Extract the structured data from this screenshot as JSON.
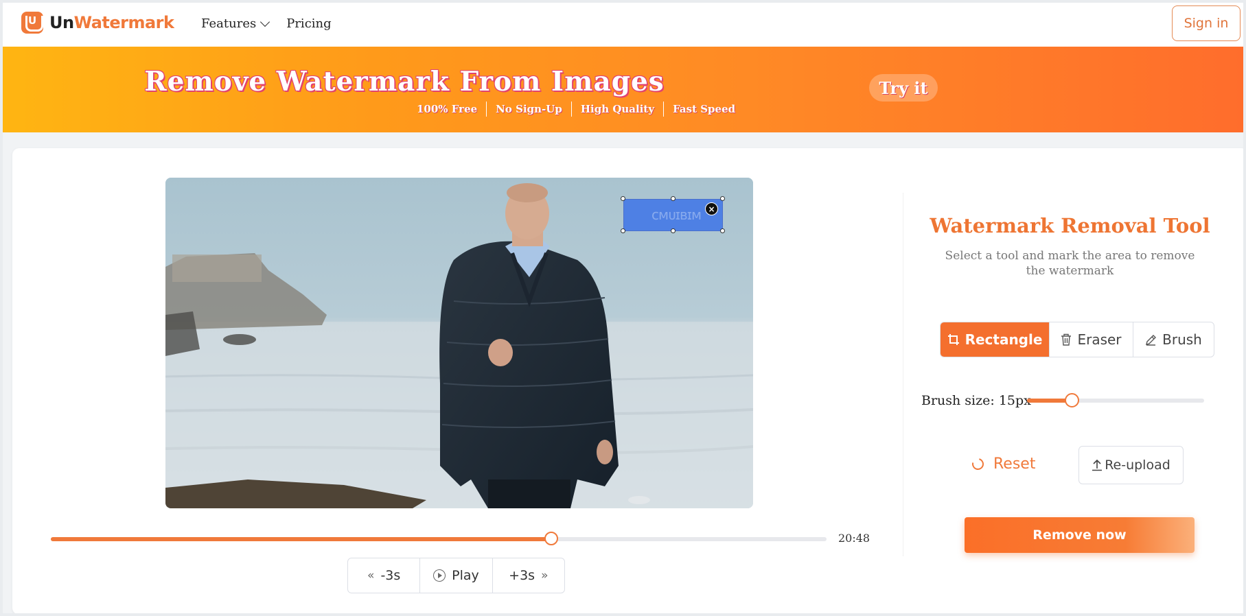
{
  "header": {
    "logo_prefix": "Un",
    "logo_suffix": "Watermark",
    "logo_mark": "U",
    "nav": [
      {
        "label": "Features",
        "has_dropdown": true
      },
      {
        "label": "Pricing",
        "has_dropdown": false
      }
    ],
    "signin_label": "Sign in"
  },
  "banner": {
    "title": "Remove Watermark From Images",
    "tags": [
      "100% Free",
      "No Sign-Up",
      "High Quality",
      "Fast Speed"
    ],
    "cta_label": "Try it"
  },
  "player": {
    "selection_close": "×",
    "progress_fraction": 0.645,
    "time_label": "20:48",
    "controls": {
      "back_label": "-3s",
      "play_label": "Play",
      "forward_label": "+3s"
    }
  },
  "panel": {
    "title": "Watermark Removal Tool",
    "subtitle": "Select a tool and mark the area to remove the watermark",
    "tools": [
      {
        "label": "Rectangle",
        "icon": "crop-icon",
        "active": true
      },
      {
        "label": "Eraser",
        "icon": "trash-icon",
        "active": false
      },
      {
        "label": "Brush",
        "icon": "pencil-icon",
        "active": false
      }
    ],
    "brush_label": "Brush size: 15px",
    "brush_fraction": 0.25,
    "reset_label": "Reset",
    "reupload_label": "Re-upload",
    "remove_label": "Remove now"
  },
  "colors": {
    "accent": "#f0793a",
    "brand_orange": "#f46f2e",
    "banner_start": "#ffb512",
    "banner_end": "#ff6d2c"
  }
}
